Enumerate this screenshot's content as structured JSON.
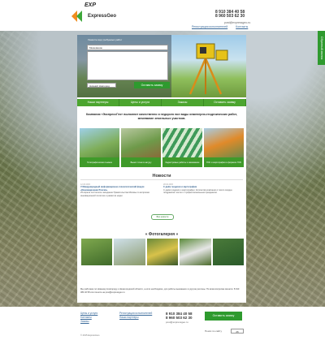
{
  "header": {
    "logo_exp": "EXP",
    "logo_name": "ExpressGeo",
    "phones": [
      "8 910 384 40 58",
      "8 960 503 62 30"
    ],
    "email": "post@expressgeo.ru",
    "links": [
      "Регистрация исполнителей",
      "Контакты"
    ]
  },
  "side_tab": "Обратный звонок",
  "hero": {
    "label": "Укажите вид требуемых работ",
    "select_value": "Межевание",
    "region_value": "Нижний Новгород",
    "button": "Оставить заявку"
  },
  "nav": [
    "Наши партнеры",
    "Цены и услуги",
    "Заказы",
    "Оставить заявку"
  ],
  "intro": "Компания «ЭкспрессГео» выполнит качественно и недорого все виды инженерно-геодезических работ, межевание земельных участков.",
  "services": [
    "Топографическая съемка",
    "Вынос точек в натуру",
    "Кадастровые работы и межевание",
    "ГИС и картография в формате ГСБ"
  ],
  "news": {
    "title": "Новости",
    "items": [
      {
        "date": "12.03.2015",
        "title": "V Международный информационно-технологический форум «Инновационная Россия»",
        "text": "25 апреля состоялось заседание Правительства Москвы по вопросам инновационной политики и развития науки."
      },
      {
        "date": "28.02.2015",
        "title": "С днём геодезии и картографии",
        "text": "С днём геодезии и картографии. Коллектив компании от всего сердца поздравляет коллег с профессиональным праздником."
      }
    ],
    "more": "Все новости"
  },
  "gallery": {
    "title": "« Фотогалерея »"
  },
  "bottom_text": "Мы работаем по Нижнему Новгороду и Нижегородской области, а если необходимо, для работы выезжаем и в другие регионы. По всем вопросам звоните: 8 910 384 40 58 или пишите на post@expressgeo.ru",
  "footer": {
    "col1": [
      "Цены и услуги",
      "Контакты",
      "Заказы"
    ],
    "col2": [
      "Регистрация исполнителей",
      "Наши партнеры"
    ],
    "phones": [
      "8 910 384 40 58",
      "8 960 503 62 30"
    ],
    "email": "post@expressgeo.ru",
    "button": "Оставить заявку",
    "search_label": "Поиск по сайту",
    "search_value": "26",
    "copyright": "© 2015 ExpressGeo"
  },
  "colors": {
    "brand_green": "#4ca52f",
    "button_green": "#2e9a2e"
  }
}
